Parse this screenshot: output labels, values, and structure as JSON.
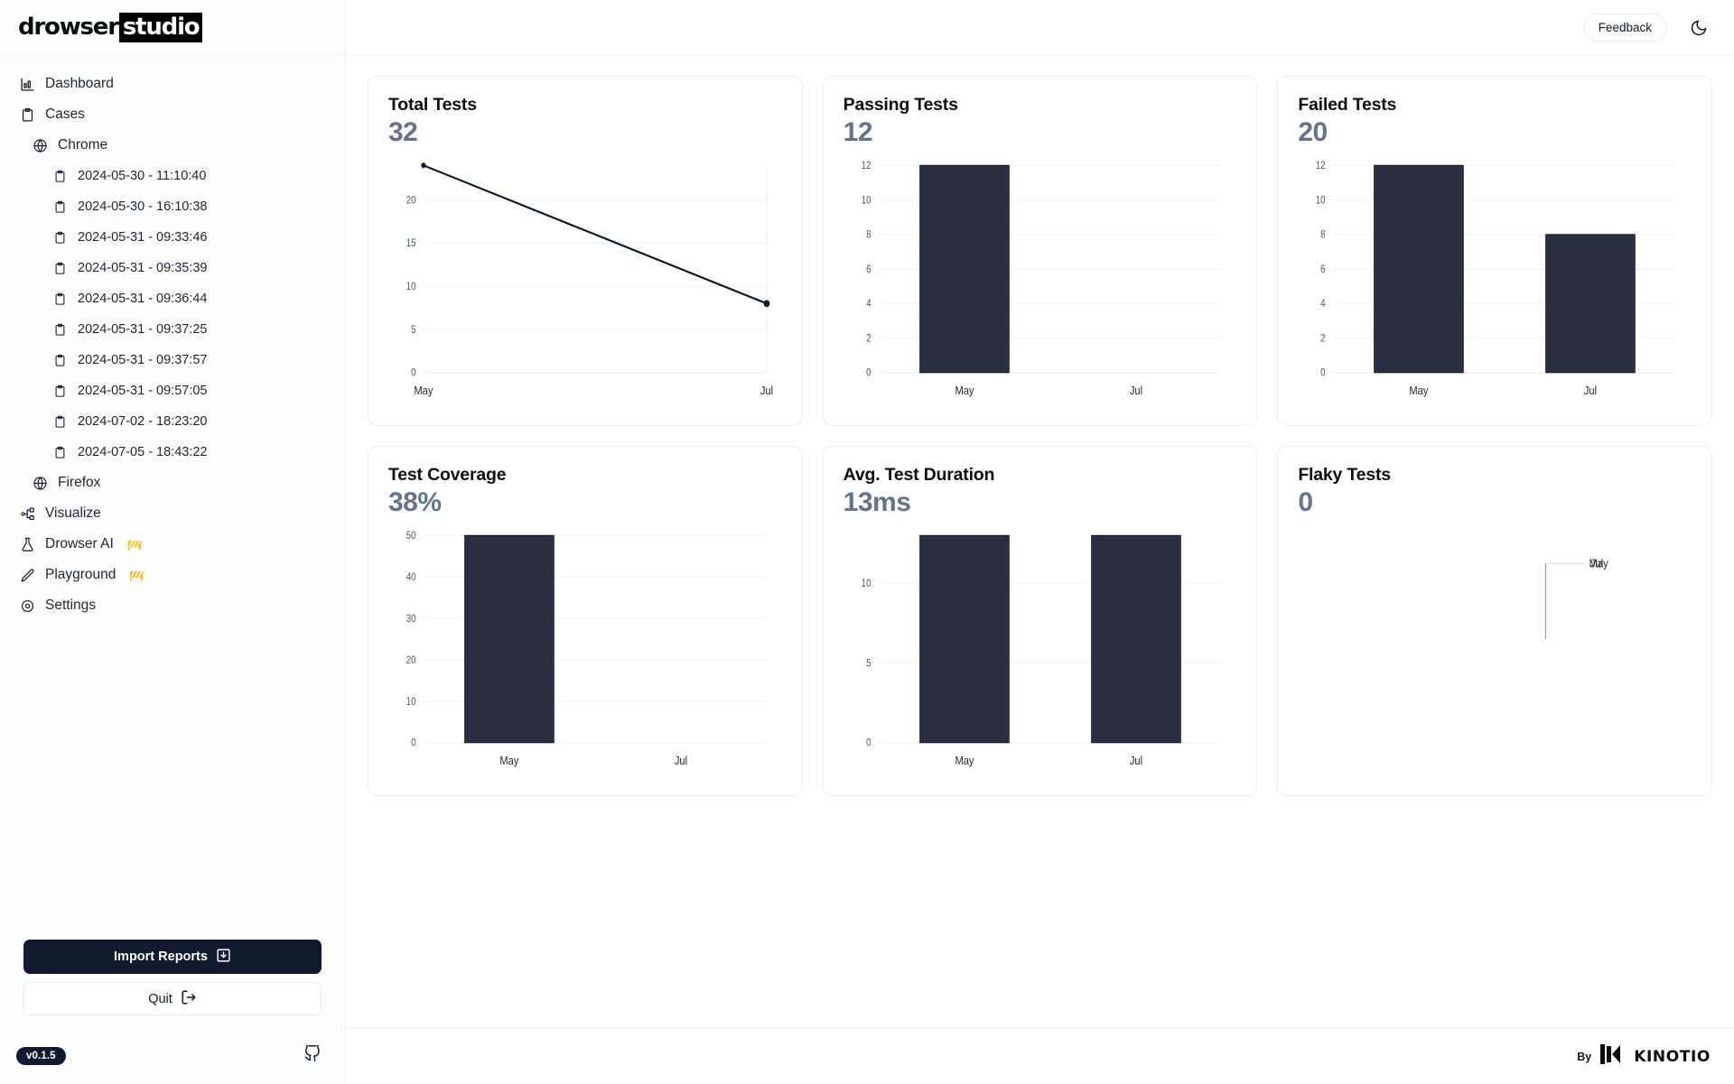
{
  "brand": {
    "logo_part1": "drowser",
    "logo_part2": "studio",
    "version": "v0.1.5"
  },
  "topbar": {
    "feedback_label": "Feedback",
    "theme_toggle_icon": "moon-icon"
  },
  "sidebar": {
    "nav": [
      {
        "label": "Dashboard",
        "icon": "bar-chart-icon",
        "level": 1
      },
      {
        "label": "Cases",
        "icon": "clipboard-icon",
        "level": 1
      },
      {
        "label": "Chrome",
        "icon": "globe-icon",
        "level": 2
      },
      {
        "label": "2024-05-30 - 11:10:40",
        "icon": "clipboard-icon",
        "level": 3
      },
      {
        "label": "2024-05-30 - 16:10:38",
        "icon": "clipboard-icon",
        "level": 3
      },
      {
        "label": "2024-05-31 - 09:33:46",
        "icon": "clipboard-icon",
        "level": 3
      },
      {
        "label": "2024-05-31 - 09:35:39",
        "icon": "clipboard-icon",
        "level": 3
      },
      {
        "label": "2024-05-31 - 09:36:44",
        "icon": "clipboard-icon",
        "level": 3
      },
      {
        "label": "2024-05-31 - 09:37:25",
        "icon": "clipboard-icon",
        "level": 3
      },
      {
        "label": "2024-05-31 - 09:37:57",
        "icon": "clipboard-icon",
        "level": 3
      },
      {
        "label": "2024-05-31 - 09:57:05",
        "icon": "clipboard-icon",
        "level": 3
      },
      {
        "label": "2024-07-02 - 18:23:20",
        "icon": "clipboard-icon",
        "level": 3
      },
      {
        "label": "2024-07-05 - 18:43:22",
        "icon": "clipboard-icon",
        "level": 3
      },
      {
        "label": "Firefox",
        "icon": "globe-icon",
        "level": 2
      },
      {
        "label": "Visualize",
        "icon": "workflow-icon",
        "level": 1
      },
      {
        "label": "Drowser AI",
        "icon": "flask-icon",
        "level": 1,
        "badge": "construction-sign"
      },
      {
        "label": "Playground",
        "icon": "pencil-icon",
        "level": 1,
        "badge": "construction-sign"
      },
      {
        "label": "Settings",
        "icon": "gear-icon",
        "level": 1
      }
    ],
    "import_label": "Import Reports",
    "import_icon": "download-icon",
    "quit_label": "Quit",
    "quit_icon": "logout-icon",
    "github_icon": "github-icon"
  },
  "footer": {
    "by_label": "By",
    "company": "KINOTIO"
  },
  "cards": [
    {
      "title": "Total Tests",
      "value": "32"
    },
    {
      "title": "Passing Tests",
      "value": "12"
    },
    {
      "title": "Failed Tests",
      "value": "20"
    },
    {
      "title": "Test Coverage",
      "value": "38%"
    },
    {
      "title": "Avg. Test Duration",
      "value": "13ms"
    },
    {
      "title": "Flaky Tests",
      "value": "0"
    }
  ],
  "chart_data": [
    {
      "type": "line",
      "title": "Total Tests",
      "categories": [
        "May",
        "Jul"
      ],
      "values": [
        24,
        8
      ],
      "yticks": [
        0,
        5,
        10,
        15,
        20
      ],
      "ylim": [
        0,
        24
      ],
      "xlabel": "",
      "ylabel": "",
      "grid": true,
      "legend": "none",
      "series_color": "#111827"
    },
    {
      "type": "bar",
      "title": "Passing Tests",
      "categories": [
        "May",
        "Jul"
      ],
      "values": [
        12,
        0
      ],
      "yticks": [
        0,
        2,
        4,
        6,
        8,
        10,
        12
      ],
      "ylim": [
        0,
        12
      ],
      "xlabel": "",
      "ylabel": "",
      "grid": true,
      "legend": "none",
      "series_color": "#2a2f42"
    },
    {
      "type": "bar",
      "title": "Failed Tests",
      "categories": [
        "May",
        "Jul"
      ],
      "values": [
        12,
        8
      ],
      "yticks": [
        0,
        2,
        4,
        6,
        8,
        10,
        12
      ],
      "ylim": [
        0,
        12
      ],
      "xlabel": "",
      "ylabel": "",
      "grid": true,
      "legend": "none",
      "series_color": "#2a2f42"
    },
    {
      "type": "bar",
      "title": "Test Coverage",
      "categories": [
        "May",
        "Jul"
      ],
      "values": [
        50,
        0
      ],
      "yticks": [
        0,
        10,
        20,
        30,
        40,
        50
      ],
      "ylim": [
        0,
        50
      ],
      "xlabel": "",
      "ylabel": "",
      "grid": true,
      "legend": "none",
      "series_color": "#2a2f42"
    },
    {
      "type": "bar",
      "title": "Avg. Test Duration",
      "categories": [
        "May",
        "Jul"
      ],
      "values": [
        13,
        13
      ],
      "yticks": [
        0,
        5,
        10
      ],
      "ylim": [
        0,
        13
      ],
      "xlabel": "",
      "ylabel": "",
      "grid": true,
      "legend": "none",
      "series_color": "#2a2f42"
    },
    {
      "type": "bar",
      "title": "Flaky Tests",
      "categories": [
        "May",
        "Jul"
      ],
      "values": [
        0,
        0
      ],
      "yticks": [],
      "ylim": [
        0,
        0
      ],
      "xlabel": "",
      "ylabel": "",
      "grid": true,
      "legend": "none",
      "series_color": "#2a2f42",
      "note": "collapsed-empty-axes"
    }
  ]
}
